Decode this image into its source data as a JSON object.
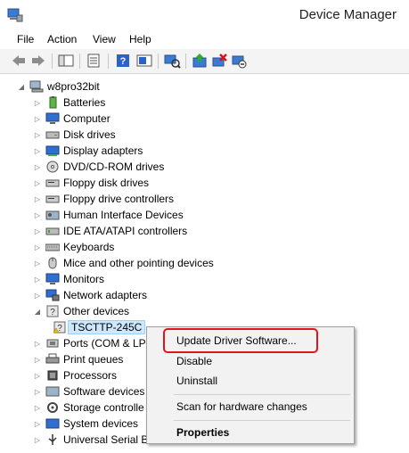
{
  "window": {
    "title": "Device Manager"
  },
  "menu": [
    "File",
    "Action",
    "View",
    "Help"
  ],
  "toolbar": {
    "buttons": [
      "back-icon",
      "forward-icon",
      "show-hide-console-tree-icon",
      "properties-icon",
      "help-icon",
      "console-icon",
      "scan-hardware-icon",
      "update-driver-icon",
      "uninstall-icon",
      "disable-icon"
    ]
  },
  "tree": {
    "root": "w8pro32bit",
    "categories": [
      "Batteries",
      "Computer",
      "Disk drives",
      "Display adapters",
      "DVD/CD-ROM drives",
      "Floppy disk drives",
      "Floppy drive controllers",
      "Human Interface Devices",
      "IDE ATA/ATAPI controllers",
      "Keyboards",
      "Mice and other pointing devices",
      "Monitors",
      "Network adapters",
      "Other devices"
    ],
    "other_device_child": "TSCTTP-245C",
    "categories_after": [
      "Ports (COM & LP",
      "Print queues",
      "Processors",
      "Software devices",
      "Storage controlle",
      "System devices",
      "Universal Serial B"
    ]
  },
  "context_menu": {
    "update": "Update Driver Software...",
    "disable": "Disable",
    "uninstall": "Uninstall",
    "scan": "Scan for hardware changes",
    "properties": "Properties"
  },
  "colors": {
    "highlight": "#e0141e",
    "selection": "#cce8ff"
  }
}
